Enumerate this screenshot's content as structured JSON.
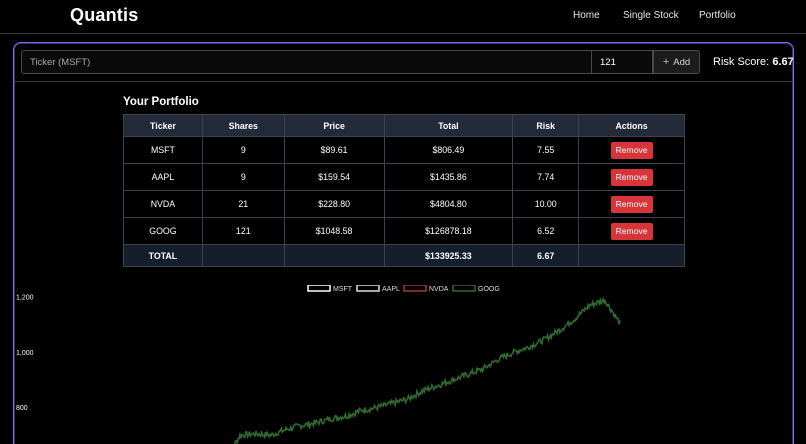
{
  "nav": {
    "brand": "Quantis",
    "links": [
      "Home",
      "Single Stock",
      "Portfolio"
    ]
  },
  "toolbar": {
    "ticker_placeholder": "Ticker (MSFT)",
    "shares_value": "121",
    "add_label": "Add",
    "risk_label": "Risk Score:",
    "risk_value": "6.67"
  },
  "portfolio": {
    "title": "Your Portfolio",
    "columns": [
      "Ticker",
      "Shares",
      "Price",
      "Total",
      "Risk",
      "Actions"
    ],
    "rows": [
      {
        "ticker": "MSFT",
        "shares": "9",
        "price": "$89.61",
        "total": "$806.49",
        "risk": "7.55",
        "action": "Remove"
      },
      {
        "ticker": "AAPL",
        "shares": "9",
        "price": "$159.54",
        "total": "$1435.86",
        "risk": "7.74",
        "action": "Remove"
      },
      {
        "ticker": "NVDA",
        "shares": "21",
        "price": "$228.80",
        "total": "$4804.80",
        "risk": "10.00",
        "action": "Remove"
      },
      {
        "ticker": "GOOG",
        "shares": "121",
        "price": "$1048.58",
        "total": "$126878.18",
        "risk": "6.52",
        "action": "Remove"
      }
    ],
    "total": {
      "label": "TOTAL",
      "total": "$133925.33",
      "risk": "6.67"
    }
  },
  "colors": {
    "MSFT": "#ffffff",
    "AAPL": "#cfe3ee",
    "NVDA": "#a33a2c",
    "GOOG": "#2f6a2f",
    "remove": "#d8353a",
    "panel_border": "#7a6cff"
  },
  "chart_data": {
    "type": "line",
    "legend": [
      "MSFT",
      "AAPL",
      "NVDA",
      "GOOG"
    ],
    "legend_placement": "top-center",
    "y_ticks": [
      "1,200",
      "1,000",
      "800"
    ],
    "ylim": [
      650,
      1200
    ],
    "series": [
      {
        "name": "GOOG",
        "values": [
          610,
          700,
          705,
          700,
          720,
          735,
          745,
          760,
          770,
          790,
          800,
          815,
          830,
          860,
          880,
          900,
          920,
          940,
          975,
          1000,
          1020,
          1045,
          1080,
          1120,
          1170,
          1190,
          1105
        ]
      }
    ]
  }
}
